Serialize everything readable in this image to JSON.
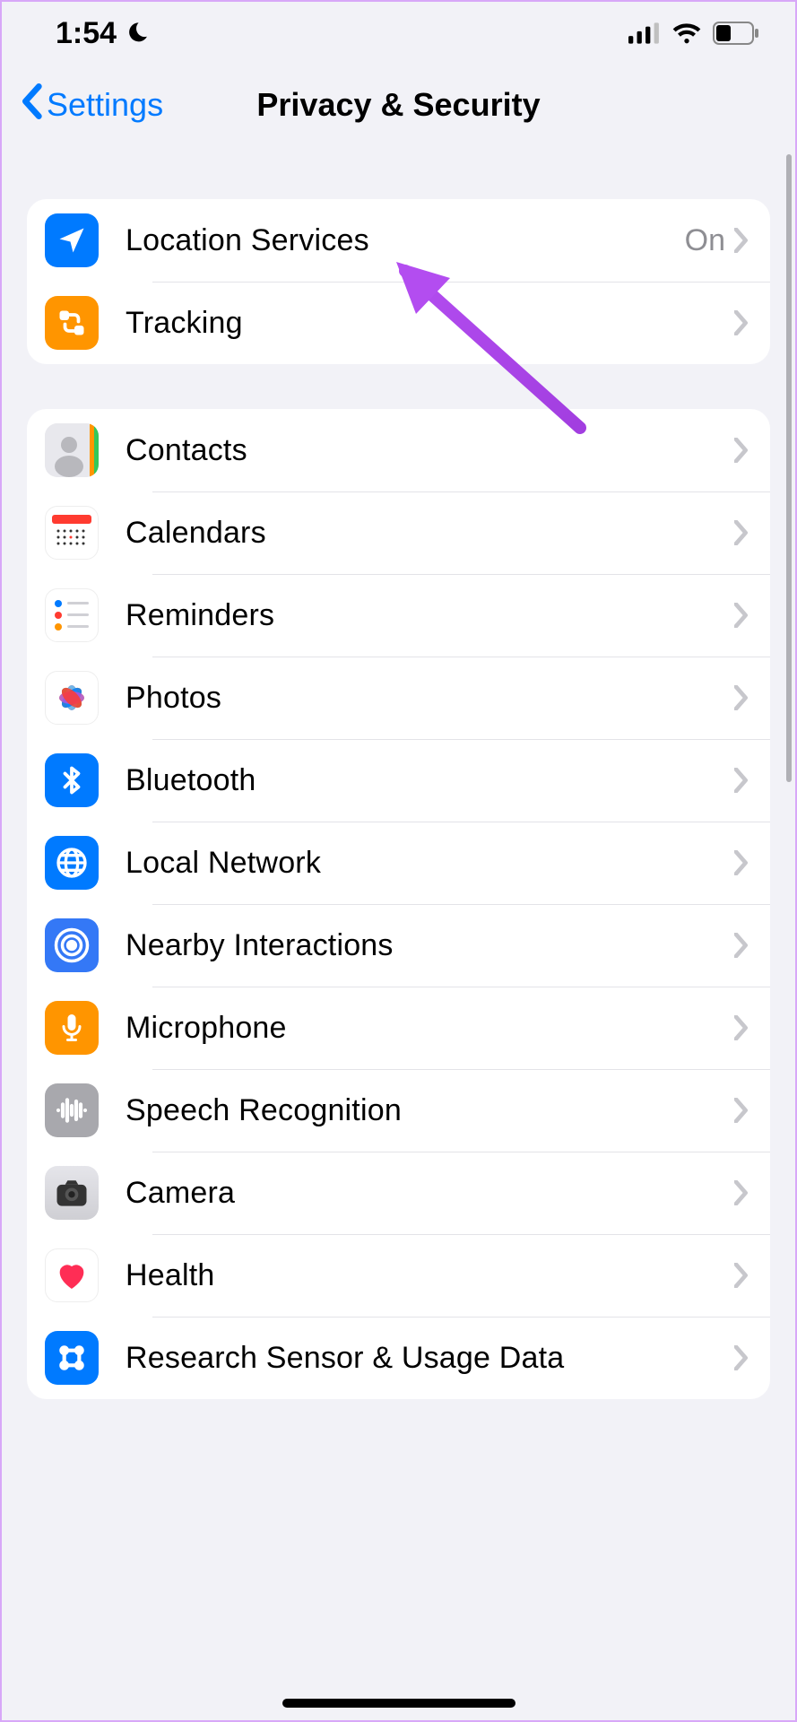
{
  "status": {
    "time": "1:54"
  },
  "nav": {
    "back_label": "Settings",
    "title": "Privacy & Security"
  },
  "section1": {
    "rows": [
      {
        "label": "Location Services",
        "value": "On"
      },
      {
        "label": "Tracking",
        "value": ""
      }
    ]
  },
  "section2": {
    "rows": [
      {
        "label": "Contacts"
      },
      {
        "label": "Calendars"
      },
      {
        "label": "Reminders"
      },
      {
        "label": "Photos"
      },
      {
        "label": "Bluetooth"
      },
      {
        "label": "Local Network"
      },
      {
        "label": "Nearby Interactions"
      },
      {
        "label": "Microphone"
      },
      {
        "label": "Speech Recognition"
      },
      {
        "label": "Camera"
      },
      {
        "label": "Health"
      },
      {
        "label": "Research Sensor & Usage Data"
      }
    ]
  }
}
